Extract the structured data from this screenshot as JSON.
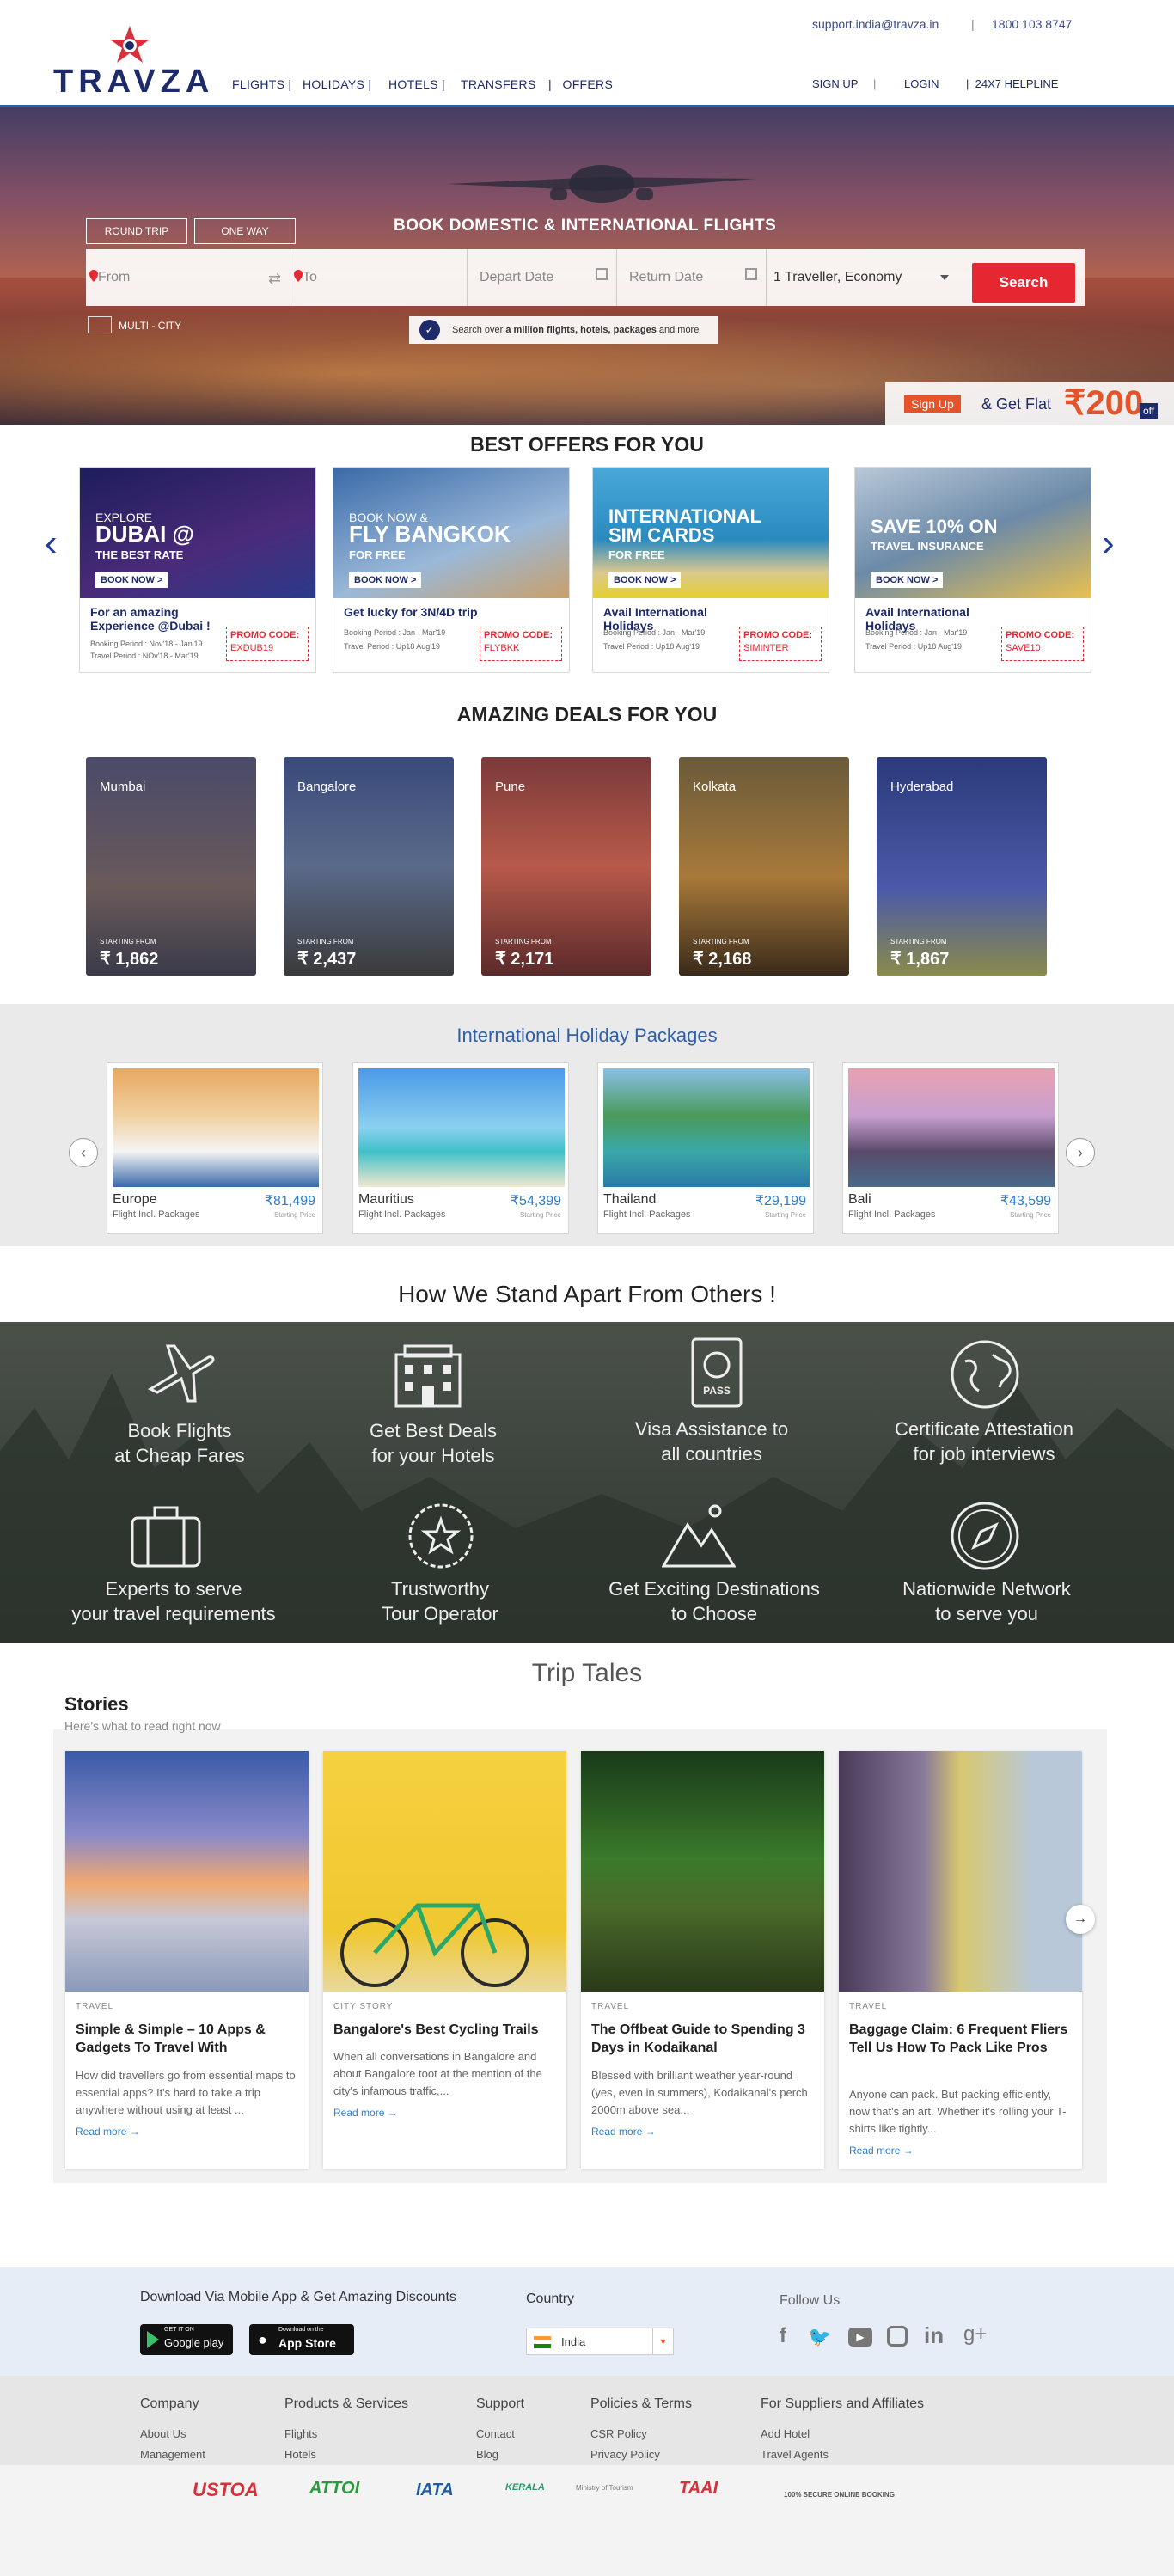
{
  "header": {
    "logo": "TRAVZA",
    "support_email": "support.india@travza.in",
    "separator": "|",
    "phone": "1800 103 8747",
    "nav": [
      "FLIGHTS",
      "HOLIDAYS",
      "HOTELS",
      "TRANSFERS",
      "OFFERS"
    ],
    "nav_right": [
      "SIGN UP",
      "LOGIN",
      "24X7 HELPLINE"
    ]
  },
  "hero": {
    "tabs": [
      "ROUND TRIP",
      "ONE WAY"
    ],
    "title": "BOOK DOMESTIC & INTERNATIONAL FLIGHTS",
    "from_placeholder": "From",
    "to_placeholder": "To",
    "depart_placeholder": "Depart Date",
    "return_placeholder": "Return Date",
    "travellers": "1 Traveller, Economy",
    "search_label": "Search",
    "multi_city": "MULTI - CITY",
    "tagline_pre": "Search over ",
    "tagline_bold": "a million flights, hotels, packages",
    "tagline_post": " and more",
    "signup_btn": "Sign Up",
    "signup_text": "& Get Flat",
    "signup_amount": "₹200",
    "signup_off": "off"
  },
  "offers": {
    "title": "BEST OFFERS FOR YOU",
    "items": [
      {
        "kicker": "EXPLORE",
        "headline": "DUBAI @",
        "sub": "THE BEST RATE",
        "cta": "BOOK NOW >",
        "title": "For an amazing Experience @Dubai !",
        "booking": "Booking Period : Nov'18 - Jan'19",
        "travel": "Travel Period : NOv'18 - Mar'19",
        "promo_label": "PROMO CODE:",
        "promo": "EXDUB19",
        "bg": "#2b2d7a"
      },
      {
        "kicker": "BOOK NOW &",
        "headline": "FLY BANGKOK",
        "sub": "FOR FREE",
        "cta": "BOOK NOW >",
        "title": "Get lucky for 3N/4D trip",
        "booking": "Booking Period : Jan - Mar'19",
        "travel": "Travel Period : Up18 Aug'19",
        "promo_label": "PROMO CODE:",
        "promo": "FLYBKK",
        "bg": "#3a6aa8"
      },
      {
        "kicker": "",
        "headline": "INTERNATIONAL SIM CARDS",
        "sub": "FOR FREE",
        "cta": "BOOK NOW >",
        "title": "Avail International Holidays",
        "booking": "Booking Period : Jan - Mar'19",
        "travel": "Travel Period : Up18 Aug'19",
        "promo_label": "PROMO CODE:",
        "promo": "SIMINTER",
        "bg": "#2a8ac0"
      },
      {
        "kicker": "",
        "headline": "SAVE 10% ON",
        "sub": "TRAVEL INSURANCE",
        "cta": "BOOK NOW >",
        "title": "Avail International Holidays",
        "booking": "Booking Period : Jan - Mar'19",
        "travel": "Travel Period : Up18 Aug'19",
        "promo_label": "PROMO CODE:",
        "promo": "SAVE10",
        "bg": "#6c8aa8"
      }
    ]
  },
  "deals": {
    "title": "AMAZING DEALS FOR YOU",
    "starting_from": "STARTING FROM",
    "items": [
      {
        "city": "Mumbai",
        "price": "₹ 1,862"
      },
      {
        "city": "Bangalore",
        "price": "₹ 2,437"
      },
      {
        "city": "Pune",
        "price": "₹ 2,171"
      },
      {
        "city": "Kolkata",
        "price": "₹ 2,168"
      },
      {
        "city": "Hyderabad",
        "price": "₹ 1,867"
      }
    ]
  },
  "packages": {
    "title": "International Holiday Packages",
    "items": [
      {
        "name": "Europe",
        "sub": "Flight Incl. Packages",
        "price": "₹81,499",
        "sp": "Starting Price"
      },
      {
        "name": "Mauritius",
        "sub": "Flight Incl. Packages",
        "price": "₹54,399",
        "sp": "Starting Price"
      },
      {
        "name": "Thailand",
        "sub": "Flight Incl. Packages",
        "price": "₹29,199",
        "sp": "Starting Price"
      },
      {
        "name": "Bali",
        "sub": "Flight Incl. Packages",
        "price": "₹43,599",
        "sp": "Starting Price"
      }
    ]
  },
  "apart": {
    "title": "How We Stand Apart From Others !",
    "features": [
      {
        "l1": "Book Flights",
        "l2": "at Cheap Fares",
        "icon": "airplane-icon"
      },
      {
        "l1": "Get Best Deals",
        "l2": "for your Hotels",
        "icon": "hotel-icon"
      },
      {
        "l1": "Visa Assistance to",
        "l2": "all countries",
        "icon": "passport-icon"
      },
      {
        "l1": "Certificate Attestation",
        "l2": "for job interviews",
        "icon": "globe-icon"
      },
      {
        "l1": "Experts to serve",
        "l2": "your travel requirements",
        "icon": "suitcase-icon"
      },
      {
        "l1": "Trustworthy",
        "l2": "Tour Operator",
        "icon": "star-badge-icon"
      },
      {
        "l1": "Get Exciting Destinations",
        "l2": "to Choose",
        "icon": "mountains-icon"
      },
      {
        "l1": "Nationwide Network",
        "l2": "to serve you",
        "icon": "compass-icon"
      }
    ]
  },
  "tales": {
    "title": "Trip Tales",
    "stories_heading": "Stories",
    "stories_sub": "Here's what to read right now",
    "read_more": "Read more →",
    "items": [
      {
        "cat": "TRAVEL",
        "title": "Simple & Simple – 10 Apps & Gadgets To Travel With",
        "desc": "How did travellers go from essential maps to essential apps? It's hard to take a trip anywhere without using at least ..."
      },
      {
        "cat": "CITY STORY",
        "title": "Bangalore's Best Cycling Trails",
        "desc": "When all conversations in Bangalore and about Bangalore toot at the mention of the city's infamous traffic,..."
      },
      {
        "cat": "TRAVEL",
        "title": "The Offbeat Guide to Spending 3 Days in Kodaikanal",
        "desc": "Blessed with brilliant weather year-round (yes, even in summers), Kodaikanal's perch 2000m above sea..."
      },
      {
        "cat": "TRAVEL",
        "title": "Baggage Claim: 6 Frequent Fliers Tell Us How To Pack Like Pros",
        "desc": "Anyone can pack. But packing efficiently, now that's an art. Whether it's rolling your T-shirts like tightly..."
      }
    ]
  },
  "app_bar": {
    "download_text": "Download Via Mobile App & Get Amazing Discounts",
    "google_small": "GET IT ON",
    "google_big": "Google play",
    "apple_small": "Download on the",
    "apple_big": "App Store",
    "country_label": "Country",
    "country_value": "India",
    "follow_label": "Follow Us"
  },
  "footer": {
    "columns": [
      {
        "h": "Company",
        "links": [
          "About Us",
          "Management"
        ]
      },
      {
        "h": "Products & Services",
        "links": [
          "Flights",
          "Hotels"
        ]
      },
      {
        "h": "Support",
        "links": [
          "Contact",
          "Blog"
        ]
      },
      {
        "h": "Policies & Terms",
        "links": [
          "CSR Policy",
          "Privacy Policy"
        ]
      },
      {
        "h": "For Suppliers and Affiliates",
        "links": [
          "Add Hotel",
          "Travel Agents"
        ]
      }
    ]
  },
  "partners": [
    "USTOA",
    "ATTOI",
    "IATA",
    "KERALA",
    "Ministry of Tourism",
    "TAAI",
    "100% SECURE ONLINE BOOKING"
  ]
}
